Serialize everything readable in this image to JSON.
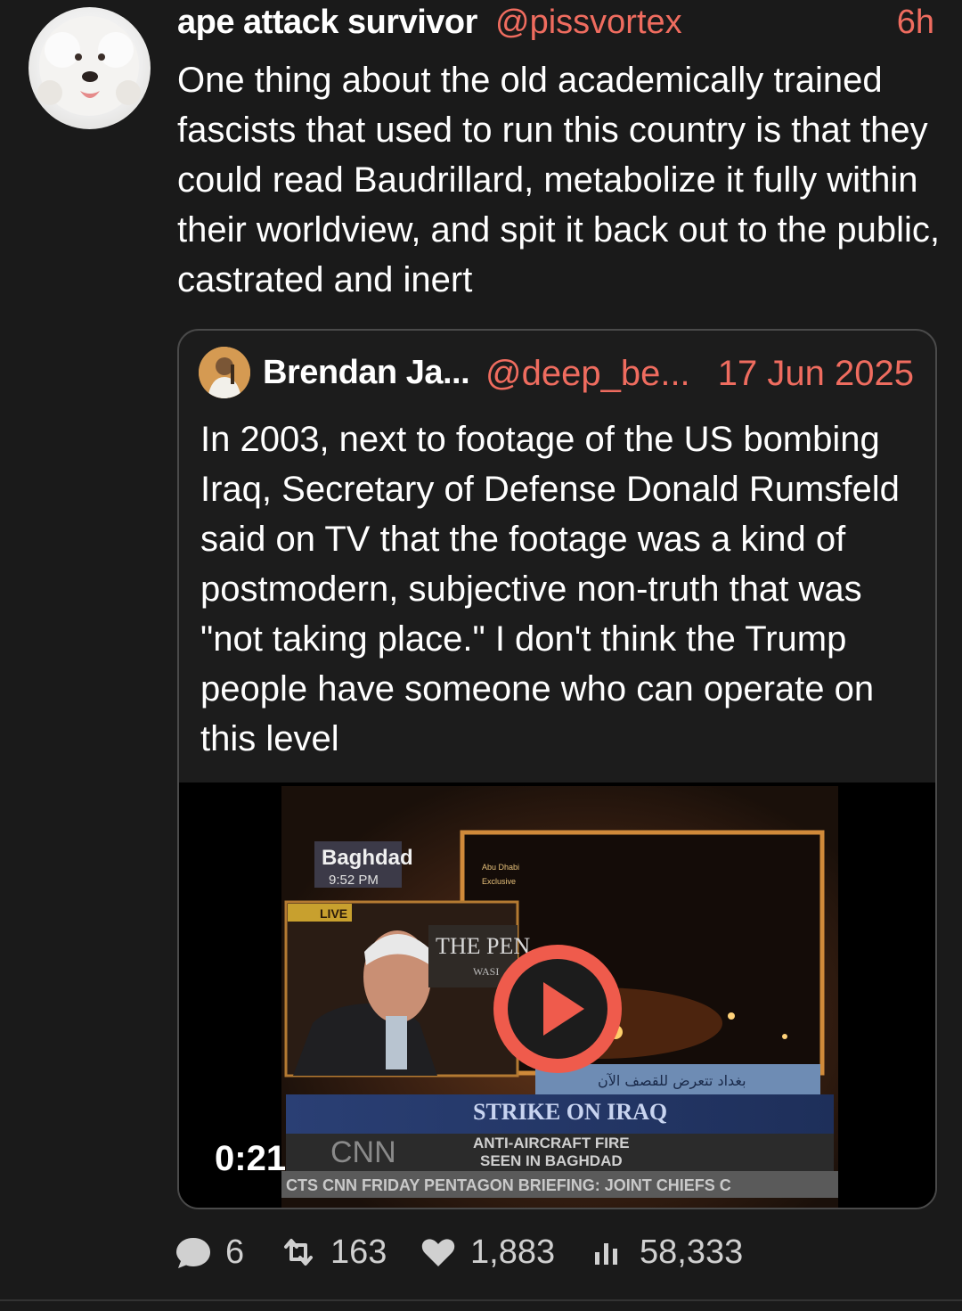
{
  "post": {
    "author_name": "ape attack survivor",
    "author_handle": "@pissvortex",
    "time_ago": "6h",
    "text": "One thing about the old academically trained fascists that used to run this country is that they could read Baudrillard, metabolize it fully within their worldview, and spit it back out to the public, castrated and inert",
    "avatar_icon": "dog-avatar"
  },
  "quote": {
    "author_name": "Brendan Ja...",
    "author_handle": "@deep_be...",
    "date": "17 Jun 2025",
    "text": "In 2003, next to footage of the US bombing Iraq, Secretary of Defense Donald Rumsfeld said on TV that the footage was a kind of postmodern, subjective non-truth that was \"not taking place.\" I don't think the Trump people have someone who can operate on this level",
    "avatar_icon": "person-avatar"
  },
  "video": {
    "duration": "0:21",
    "play_icon": "play-icon",
    "location": "Baghdad",
    "clock": "9:52 PM",
    "live": "LIVE",
    "pentagon_sign": "THE PEN",
    "pentagon_sub": "WASI",
    "abudhabi": "Abu Dhabi",
    "exclusive": "Exclusive",
    "arabic_caption": "بغداد تتعرض للقصف الآن",
    "strike_title": "STRIKE ON IRAQ",
    "headline_1": "ANTI-AIRCRAFT FIRE",
    "headline_2": "SEEN IN BAGHDAD",
    "network": "CNN",
    "ticker": "CTS  CNN  FRIDAY PENTAGON BRIEFING: JOINT CHIEFS C"
  },
  "actions": {
    "replies": "6",
    "reposts": "163",
    "likes": "1,883",
    "views": "58,333"
  },
  "colors": {
    "background": "#1a1a1a",
    "accent": "#ef6c5f",
    "border": "#4a4a4a"
  }
}
